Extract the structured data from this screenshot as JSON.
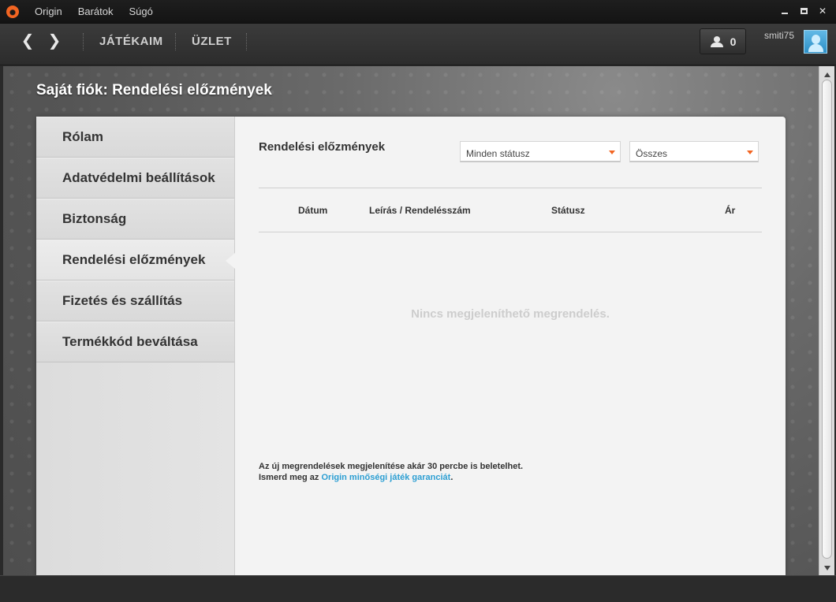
{
  "menu": {
    "items": [
      "Origin",
      "Barátok",
      "Súgó"
    ]
  },
  "window_controls": {
    "close": "✕"
  },
  "nav": {
    "back": "❮",
    "forward": "❯",
    "links": [
      "JÁTÉKAIM",
      "ÜZLET"
    ],
    "friends_count": "0",
    "username": "smiti75"
  },
  "page": {
    "title": "Saját fiók: Rendelési előzmények"
  },
  "sidebar": {
    "items": [
      {
        "label": "Rólam",
        "active": false
      },
      {
        "label": "Adatvédelmi beállítások",
        "active": false
      },
      {
        "label": "Biztonság",
        "active": false
      },
      {
        "label": "Rendelési előzmények",
        "active": true
      },
      {
        "label": "Fizetés és szállítás",
        "active": false
      },
      {
        "label": "Termékkód beváltása",
        "active": false
      }
    ]
  },
  "orders": {
    "title": "Rendelési előzmények",
    "status_filter": "Minden státusz",
    "time_filter": "Összes",
    "columns": [
      "Dátum",
      "Leírás / Rendelésszám",
      "Státusz",
      "Ár"
    ],
    "empty_message": "Nincs megjeleníthető megrendelés.",
    "note_line1": "Az új megrendelések megjelenítése akár 30 percbe is beletelhet.",
    "note_line2_prefix": "Ismerd meg az ",
    "note_link": "Origin minőségi játék garanciát",
    "note_line2_suffix": "."
  },
  "colors": {
    "accent": "#f26522",
    "link": "#2d9fd3"
  }
}
